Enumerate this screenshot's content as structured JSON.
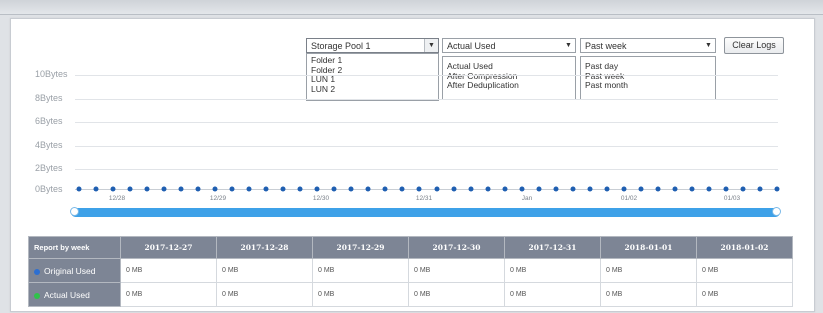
{
  "controls": {
    "pool": {
      "selected": "Storage Pool 1",
      "options": [
        "Folder 1",
        "Folder 2",
        "LUN 1",
        "LUN 2"
      ]
    },
    "metric": {
      "selected": "Actual Used",
      "options": [
        "Actual Used",
        "After Compression",
        "After Deduplication"
      ]
    },
    "period": {
      "selected": "Past week",
      "options": [
        "Past day",
        "Past week",
        "Past month"
      ]
    },
    "clear_logs_label": "Clear Logs"
  },
  "chart_data": {
    "type": "line",
    "y_ticks": [
      "10Bytes",
      "8Bytes",
      "6Bytes",
      "4Bytes",
      "2Bytes",
      "0Bytes"
    ],
    "ylim": [
      0,
      10
    ],
    "x_ticks": [
      "12/28",
      "12/29",
      "12/30",
      "12/31",
      "Jan",
      "01/02",
      "01/03"
    ],
    "series": [
      {
        "values": [
          0,
          0,
          0,
          0,
          0,
          0,
          0,
          0,
          0,
          0,
          0,
          0,
          0,
          0,
          0,
          0,
          0,
          0,
          0,
          0,
          0,
          0,
          0,
          0,
          0,
          0,
          0,
          0,
          0,
          0,
          0,
          0,
          0,
          0,
          0,
          0,
          0,
          0,
          0,
          0,
          0,
          0
        ]
      }
    ],
    "colors": {
      "line": "#1f5fb1",
      "range": "#3ea1e8"
    }
  },
  "table": {
    "corner": "Report by week",
    "columns": [
      "2017-12-27",
      "2017-12-28",
      "2017-12-29",
      "2017-12-30",
      "2017-12-31",
      "2018-01-01",
      "2018-01-02"
    ],
    "rows": [
      {
        "label": "Original Used",
        "color": "#2d6fd1",
        "cells": [
          "0 MB",
          "0 MB",
          "0 MB",
          "0 MB",
          "0 MB",
          "0 MB",
          "0 MB"
        ]
      },
      {
        "label": "Actual Used",
        "color": "#2fc24a",
        "cells": [
          "0 MB",
          "0 MB",
          "0 MB",
          "0 MB",
          "0 MB",
          "0 MB",
          "0 MB"
        ]
      }
    ]
  }
}
